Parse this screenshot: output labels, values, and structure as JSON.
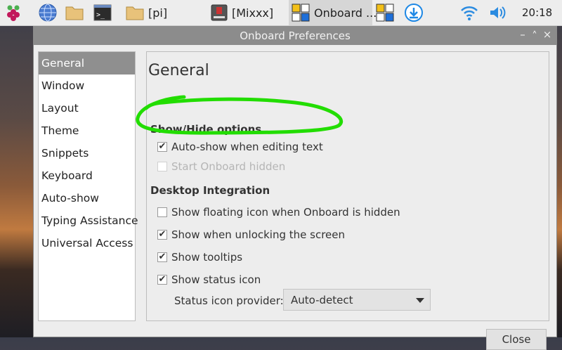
{
  "taskbar": {
    "items": [
      {
        "name": "raspberry-menu"
      },
      {
        "name": "browser"
      },
      {
        "name": "file-manager"
      },
      {
        "name": "terminal"
      },
      {
        "name": "pi-folder",
        "label": "[pi]"
      },
      {
        "name": "mixxx",
        "label": "[Mixxx]"
      },
      {
        "name": "onboard",
        "label": "Onboard ..."
      },
      {
        "name": "onboard-tray"
      },
      {
        "name": "download"
      },
      {
        "name": "wifi"
      },
      {
        "name": "volume"
      }
    ],
    "clock": "20:18"
  },
  "window": {
    "title": "Onboard Preferences",
    "controls": [
      "–",
      "˄",
      "×"
    ]
  },
  "sidebar": {
    "items": [
      {
        "label": "General",
        "selected": true
      },
      {
        "label": "Window"
      },
      {
        "label": "Layout"
      },
      {
        "label": "Theme"
      },
      {
        "label": "Snippets"
      },
      {
        "label": "Keyboard"
      },
      {
        "label": "Auto-show"
      },
      {
        "label": "Typing Assistance"
      },
      {
        "label": "Universal Access"
      }
    ]
  },
  "content": {
    "heading": "General",
    "show_hide_section": "Show/Hide options",
    "auto_show": {
      "label": "Auto-show when editing text",
      "checked": true
    },
    "start_hidden": {
      "label": "Start Onboard hidden",
      "checked": false,
      "disabled": true
    },
    "desktop_section": "Desktop Integration",
    "floating_icon": {
      "label": "Show floating icon when Onboard is hidden",
      "checked": false
    },
    "unlock_screen": {
      "label": "Show when unlocking the screen",
      "checked": true
    },
    "tooltips": {
      "label": "Show tooltips",
      "checked": true
    },
    "status_icon": {
      "label": "Show status icon",
      "checked": true
    },
    "status_provider_label": "Status icon provider:",
    "status_provider_value": "Auto-detect",
    "close_label": "Close"
  },
  "colors": {
    "annotation": "#22dd00",
    "titlebar": "#8c8c8c",
    "selected": "#8f8f8f"
  }
}
